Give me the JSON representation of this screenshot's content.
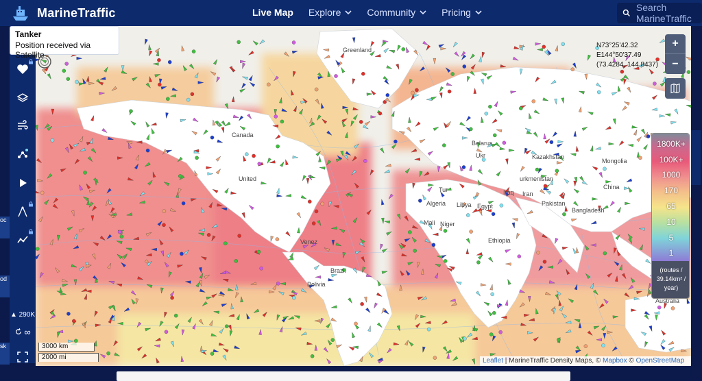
{
  "header": {
    "brand": "MarineTraffic",
    "nav": [
      {
        "label": "Live Map",
        "active": true
      },
      {
        "label": "Explore",
        "dropdown": true
      },
      {
        "label": "Community",
        "dropdown": true
      },
      {
        "label": "Pricing",
        "dropdown": true
      }
    ],
    "search_placeholder": "Search MarineTraffic"
  },
  "sidebar": {
    "items": [
      {
        "icon": "favorites-heart-icon",
        "locked": true
      },
      {
        "icon": "layers-stack-icon",
        "locked": false
      },
      {
        "icon": "weather-wind-icon",
        "locked": false
      },
      {
        "icon": "network-nodes-icon",
        "locked": false
      },
      {
        "icon": "play-icon",
        "locked": false
      },
      {
        "icon": "measure-compass-icon",
        "locked": true
      },
      {
        "icon": "analytics-line-icon",
        "locked": true
      }
    ],
    "vessel_count": "290K",
    "infinite_label": "∞"
  },
  "tooltip": {
    "title": "Tanker",
    "subtitle": "Position received via Satellite"
  },
  "coordinates": {
    "lat": "N73°25'42.32",
    "lon": "E144°50'37.49",
    "decimal": "(73.4284, 144.8437)"
  },
  "zoom": {
    "in": "+",
    "out": "−"
  },
  "legend": {
    "labels": [
      "1800K+",
      "100K+",
      "1000",
      "170",
      "65",
      "10",
      "5",
      "1"
    ],
    "unit_lines": [
      "(routes /",
      "39.14km² /",
      "year)"
    ]
  },
  "scalebar": {
    "km": "3000 km",
    "mi": "2000 mi"
  },
  "attribution": {
    "leaflet": "Leaflet",
    "sep1": " | MarineTraffic Density Maps, © ",
    "mapbox": "Mapbox",
    "sep2": " © ",
    "osm": "OpenStreetMap"
  },
  "map_labels": {
    "greenland": "Greenland",
    "canada": "Canada",
    "united": "United",
    "belarus": "Belarus",
    "ukr": "Ukr",
    "kazakhstan": "Kazakhstan",
    "mongolia": "Mongolia",
    "china": "China",
    "tur": "Tur",
    "urkmenistan": "urkmenistan",
    "iraq": "Iraq",
    "iran": "Iran",
    "pakistan": "Pakistan",
    "algeria": "Algeria",
    "libya": "Libya",
    "egypt": "Egypt",
    "mali": "Mali",
    "niger": "Niger",
    "ethiopia": "Ethiopia",
    "venez": "Venez",
    "brazil": "Brazil",
    "bolivia": "Bolivia",
    "bangladesh": "Bangladesh",
    "australia": "Australia",
    "edge_oc": "oc",
    "edge_od": "od",
    "edge_sk": "sk"
  },
  "colors": {
    "header_bg": "#0d2a6d",
    "cargo_green": "#3fbf3f",
    "tanker_red": "#e0302a",
    "passenger_blue": "#1d3fcf",
    "tug_cyan": "#7fe0f0",
    "pleasure_magenta": "#d15be0"
  }
}
